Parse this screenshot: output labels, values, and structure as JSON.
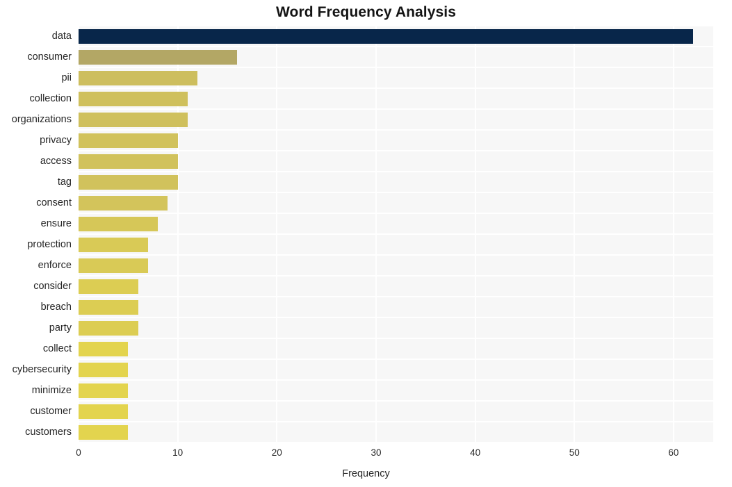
{
  "chart_data": {
    "type": "bar",
    "orientation": "horizontal",
    "title": "Word Frequency Analysis",
    "xlabel": "Frequency",
    "ylabel": "",
    "categories": [
      "data",
      "consumer",
      "pii",
      "collection",
      "organizations",
      "privacy",
      "access",
      "tag",
      "consent",
      "ensure",
      "protection",
      "enforce",
      "consider",
      "breach",
      "party",
      "collect",
      "cybersecurity",
      "minimize",
      "customer",
      "customers"
    ],
    "values": [
      62,
      16,
      12,
      11,
      11,
      10,
      10,
      10,
      9,
      8,
      7,
      7,
      6,
      6,
      6,
      5,
      5,
      5,
      5,
      5
    ],
    "bar_colors": [
      "#08264a",
      "#b3a765",
      "#cdbe5e",
      "#cfc05d",
      "#cfc05d",
      "#d1c25c",
      "#d1c25c",
      "#d1c25c",
      "#d3c45b",
      "#d6c758",
      "#d9ca56",
      "#d9ca56",
      "#dccd53",
      "#dccd53",
      "#dccd53",
      "#e3d44e",
      "#e3d44e",
      "#e3d44e",
      "#e3d44e",
      "#e3d44e"
    ],
    "xlim": [
      0,
      64
    ],
    "ylim_count": 20,
    "xticks": [
      0,
      10,
      20,
      30,
      40,
      50,
      60
    ],
    "xtick_labels": [
      "0",
      "10",
      "20",
      "30",
      "40",
      "50",
      "60"
    ],
    "grid": true,
    "grid_color": "#ffffff",
    "plot_background": "#f7f7f7",
    "figure_background": "#ffffff",
    "legend": "none",
    "title_color": "#141414",
    "tick_label_color": "#262626"
  }
}
